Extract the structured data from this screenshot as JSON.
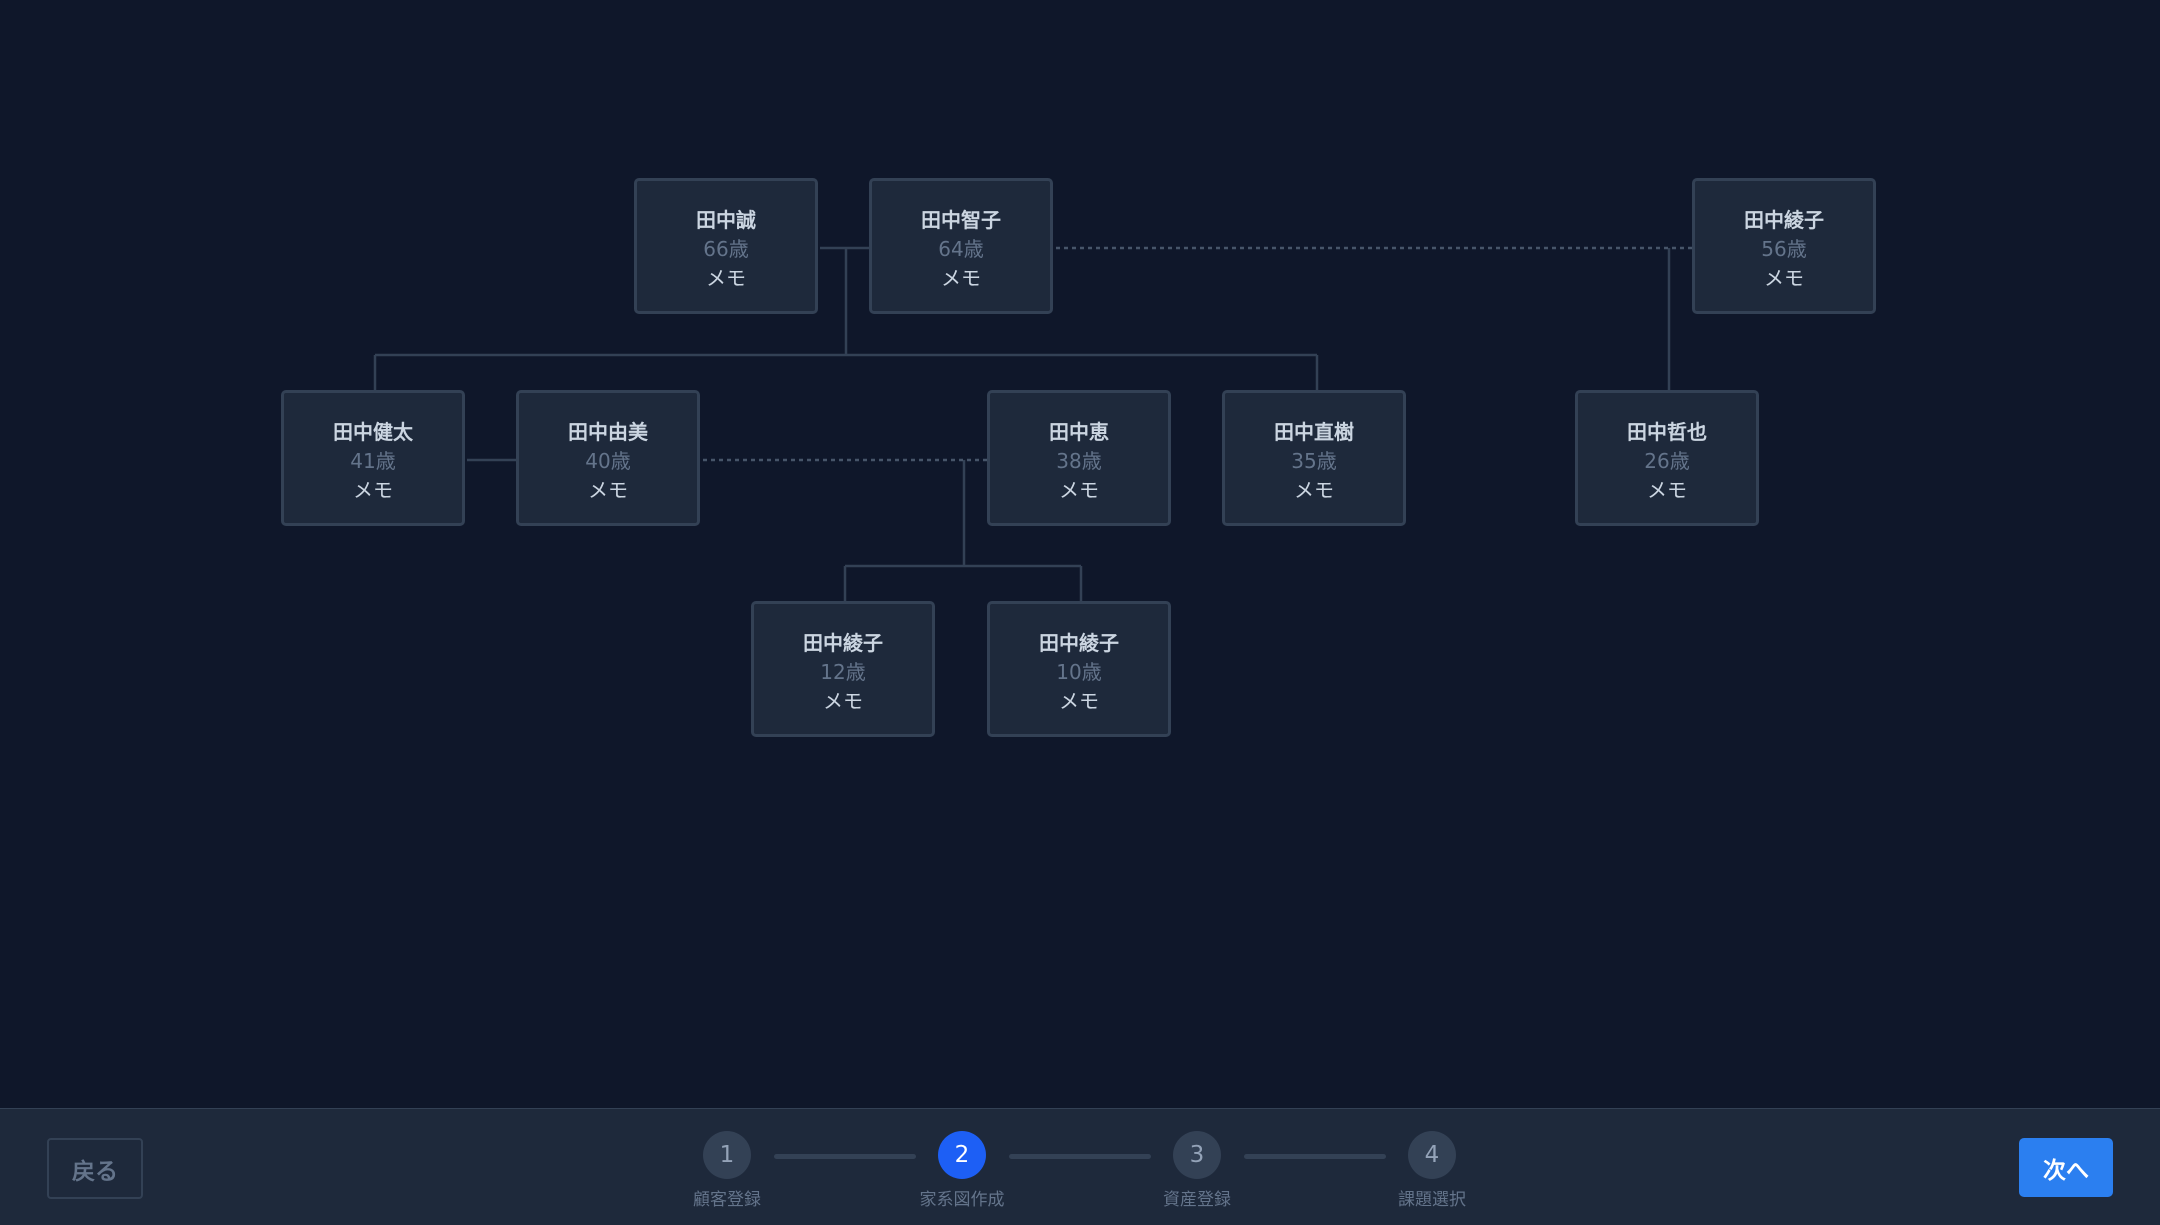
{
  "family_tree": {
    "members": {
      "makoto": {
        "name": "田中誠",
        "age": "66歳",
        "memo": "メモ"
      },
      "tomoko": {
        "name": "田中智子",
        "age": "64歳",
        "memo": "メモ"
      },
      "ayako_p": {
        "name": "田中綾子",
        "age": "56歳",
        "memo": "メモ"
      },
      "kenta": {
        "name": "田中健太",
        "age": "41歳",
        "memo": "メモ"
      },
      "yumi": {
        "name": "田中由美",
        "age": "40歳",
        "memo": "メモ"
      },
      "megumi": {
        "name": "田中恵",
        "age": "38歳",
        "memo": "メモ"
      },
      "naoki": {
        "name": "田中直樹",
        "age": "35歳",
        "memo": "メモ"
      },
      "tetsuya": {
        "name": "田中哲也",
        "age": "26歳",
        "memo": "メモ"
      },
      "ayako_a": {
        "name": "田中綾子",
        "age": "12歳",
        "memo": "メモ"
      },
      "ayako_b": {
        "name": "田中綾子",
        "age": "10歳",
        "memo": "メモ"
      }
    }
  },
  "footer": {
    "back_label": "戻る",
    "next_label": "次へ",
    "steps": [
      {
        "number": "1",
        "label": "顧客登録"
      },
      {
        "number": "2",
        "label": "家系図作成"
      },
      {
        "number": "3",
        "label": "資産登録"
      },
      {
        "number": "4",
        "label": "課題選択"
      }
    ],
    "current_step": 2
  },
  "colors": {
    "background": "#0f172a",
    "card": "#1e293b",
    "border": "#334155",
    "accent": "#2b7ff0",
    "active_step": "#1d5ff5"
  }
}
